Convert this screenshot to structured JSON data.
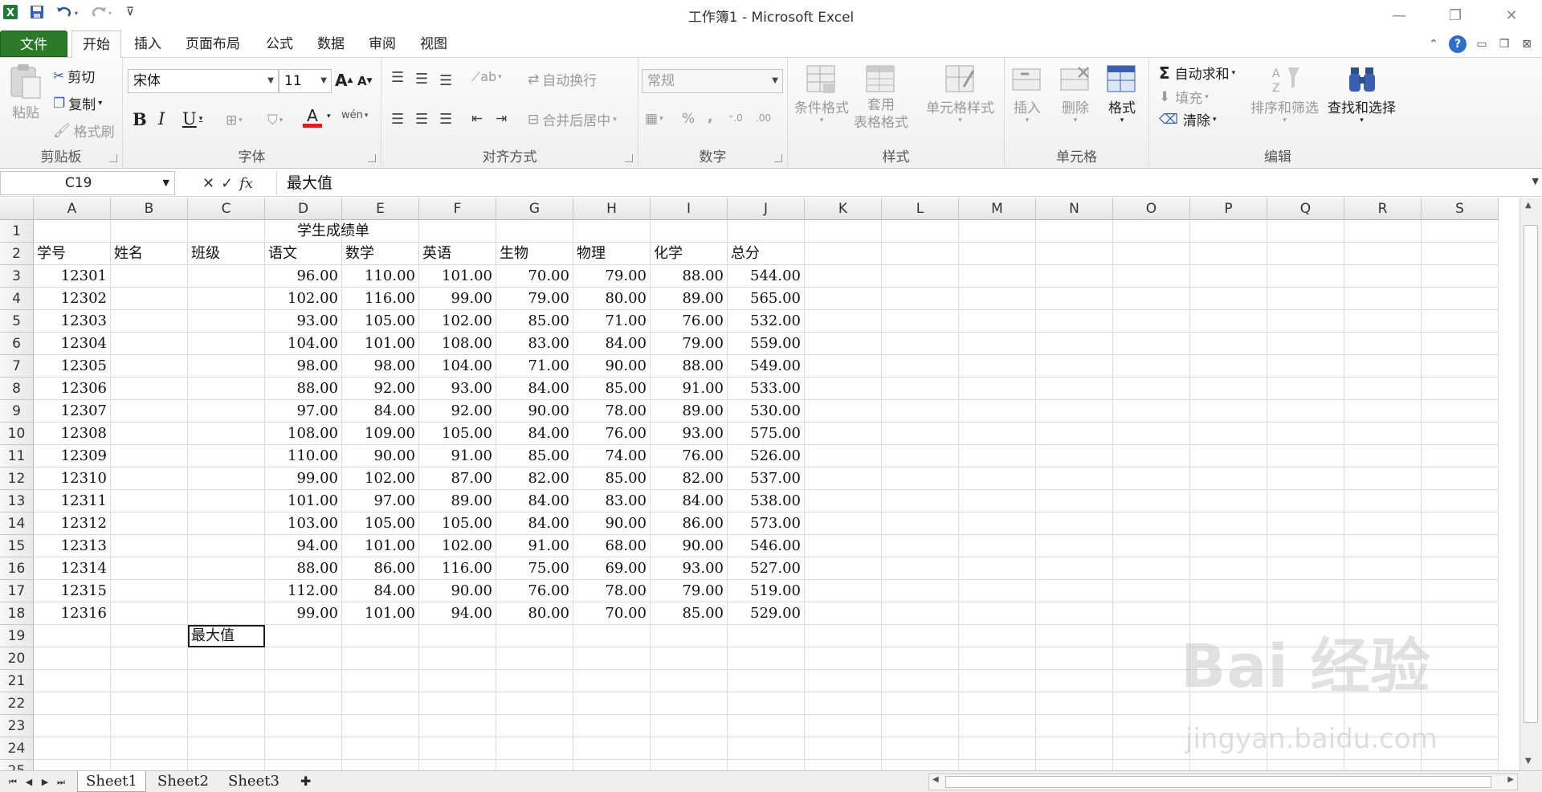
{
  "app": {
    "title": "工作簿1 - Microsoft Excel",
    "accent": "#2a7a2a"
  },
  "qat": {
    "undo_icon": "undo-icon",
    "redo_icon": "redo-icon",
    "save_icon": "save-icon",
    "excel_icon": "excel-logo-icon",
    "customize_symbol": "⊽"
  },
  "window": {
    "minimize": "—",
    "restore": "❐",
    "close": "✕"
  },
  "tabs": [
    "文件",
    "开始",
    "插入",
    "页面布局",
    "公式",
    "数据",
    "审阅",
    "视图"
  ],
  "ribbon": {
    "clipboard": {
      "label": "剪贴板",
      "paste": "粘贴",
      "cut": "剪切",
      "copy": "复制",
      "format_painter": "格式刷"
    },
    "font": {
      "label": "字体",
      "name": "宋体",
      "size": "11",
      "grow": "A",
      "shrink": "A",
      "bold": "B",
      "italic": "I",
      "underline": "U",
      "font_color_letter": "A",
      "wen": "wén",
      "font_color": "#e02020"
    },
    "alignment": {
      "label": "对齐方式",
      "wrap": "自动换行",
      "merge": "合并后居中"
    },
    "number": {
      "label": "数字",
      "format": "常规",
      "percent": "%",
      "comma": ","
    },
    "styles": {
      "label": "样式",
      "conditional": "条件格式",
      "table_line1": "套用",
      "table_line2": "表格格式",
      "cell_styles": "单元格样式"
    },
    "cells": {
      "label": "单元格",
      "insert": "插入",
      "delete": "删除",
      "format": "格式"
    },
    "editing": {
      "label": "编辑",
      "autosum": "自动求和",
      "sigma": "Σ",
      "fill": "填充",
      "clear": "清除",
      "sort": "排序和筛选",
      "find": "查找和选择"
    }
  },
  "formula_bar": {
    "name_box": "C19",
    "fx": "fx",
    "content": "最大值"
  },
  "sheet": {
    "columns": [
      "A",
      "B",
      "C",
      "D",
      "E",
      "F",
      "G",
      "H",
      "I",
      "J",
      "K",
      "L",
      "M",
      "N",
      "O",
      "P",
      "Q",
      "R",
      "S"
    ],
    "row_numbers": [
      "1",
      "2",
      "3",
      "4",
      "5",
      "6",
      "7",
      "8",
      "9",
      "10",
      "11",
      "12",
      "13",
      "14",
      "15",
      "16",
      "17",
      "18",
      "19",
      "20",
      "21",
      "22",
      "23",
      "24",
      "25"
    ],
    "title": "学生成绩单",
    "headers": [
      "学号",
      "姓名",
      "班级",
      "语文",
      "数学",
      "英语",
      "生物",
      "物理",
      "化学",
      "总分"
    ],
    "rows": [
      [
        "12301",
        "",
        "",
        "96.00",
        "110.00",
        "101.00",
        "70.00",
        "79.00",
        "88.00",
        "544.00"
      ],
      [
        "12302",
        "",
        "",
        "102.00",
        "116.00",
        "99.00",
        "79.00",
        "80.00",
        "89.00",
        "565.00"
      ],
      [
        "12303",
        "",
        "",
        "93.00",
        "105.00",
        "102.00",
        "85.00",
        "71.00",
        "76.00",
        "532.00"
      ],
      [
        "12304",
        "",
        "",
        "104.00",
        "101.00",
        "108.00",
        "83.00",
        "84.00",
        "79.00",
        "559.00"
      ],
      [
        "12305",
        "",
        "",
        "98.00",
        "98.00",
        "104.00",
        "71.00",
        "90.00",
        "88.00",
        "549.00"
      ],
      [
        "12306",
        "",
        "",
        "88.00",
        "92.00",
        "93.00",
        "84.00",
        "85.00",
        "91.00",
        "533.00"
      ],
      [
        "12307",
        "",
        "",
        "97.00",
        "84.00",
        "92.00",
        "90.00",
        "78.00",
        "89.00",
        "530.00"
      ],
      [
        "12308",
        "",
        "",
        "108.00",
        "109.00",
        "105.00",
        "84.00",
        "76.00",
        "93.00",
        "575.00"
      ],
      [
        "12309",
        "",
        "",
        "110.00",
        "90.00",
        "91.00",
        "85.00",
        "74.00",
        "76.00",
        "526.00"
      ],
      [
        "12310",
        "",
        "",
        "99.00",
        "102.00",
        "87.00",
        "82.00",
        "85.00",
        "82.00",
        "537.00"
      ],
      [
        "12311",
        "",
        "",
        "101.00",
        "97.00",
        "89.00",
        "84.00",
        "83.00",
        "84.00",
        "538.00"
      ],
      [
        "12312",
        "",
        "",
        "103.00",
        "105.00",
        "105.00",
        "84.00",
        "90.00",
        "86.00",
        "573.00"
      ],
      [
        "12313",
        "",
        "",
        "94.00",
        "101.00",
        "102.00",
        "91.00",
        "68.00",
        "90.00",
        "546.00"
      ],
      [
        "12314",
        "",
        "",
        "88.00",
        "86.00",
        "116.00",
        "75.00",
        "69.00",
        "93.00",
        "527.00"
      ],
      [
        "12315",
        "",
        "",
        "112.00",
        "84.00",
        "90.00",
        "76.00",
        "78.00",
        "79.00",
        "519.00"
      ],
      [
        "12316",
        "",
        "",
        "99.00",
        "101.00",
        "94.00",
        "80.00",
        "70.00",
        "85.00",
        "529.00"
      ]
    ],
    "c19": "最大值"
  },
  "sheet_tabs": [
    "Sheet1",
    "Sheet2",
    "Sheet3"
  ],
  "watermark": {
    "brand": "Bai 经验",
    "url": "jingyan.baidu.com"
  }
}
